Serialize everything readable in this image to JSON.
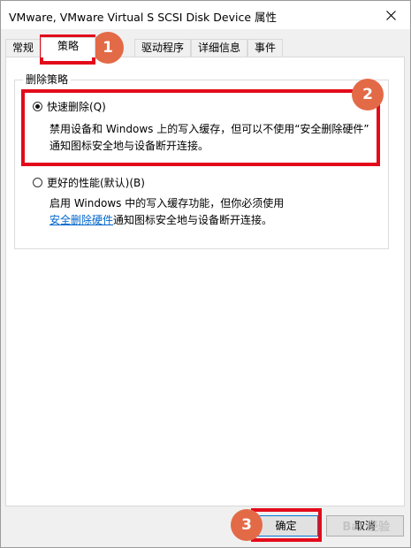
{
  "window": {
    "title": "VMware, VMware Virtual S SCSI Disk Device 属性"
  },
  "tabs": [
    {
      "label": "常规"
    },
    {
      "label": "策略"
    },
    {
      "label": "驱动程序"
    },
    {
      "label": "详细信息"
    },
    {
      "label": "事件"
    }
  ],
  "policy": {
    "group_title": "删除策略",
    "quick_removal": {
      "label": "快速删除(Q)",
      "desc_line1": "禁用设备和 Windows 上的写入缓存，但可以不使用“安全删除硬件”",
      "desc_line2": "通知图标安全地与设备断开连接。",
      "selected": true
    },
    "better_performance": {
      "label": "更好的性能(默认)(B)",
      "desc_line1": "启用 Windows 中的写入缓存功能，但你必须使用",
      "link_text": "安全删除硬件",
      "desc_line2_rest": "通知图标安全地与设备断开连接。",
      "selected": false
    }
  },
  "buttons": {
    "ok": "确定",
    "cancel": "取消"
  },
  "annotations": {
    "badge1": "1",
    "badge2": "2",
    "badge3": "3",
    "color": "#e30b1b",
    "badge_color": "#e36a47"
  },
  "watermark": "Bai 经验"
}
